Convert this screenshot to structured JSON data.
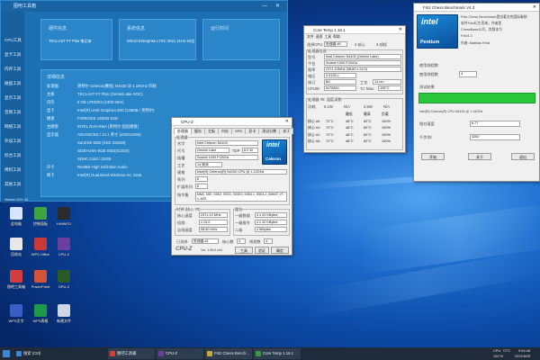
{
  "toolbox": {
    "title": "图吧工具箱",
    "sidebar": [
      "CPU工具",
      "显卡工具",
      "内存工具",
      "磁盘工具",
      "显示工具",
      "音频工具",
      "网络工具",
      "外设工具",
      "综合工具",
      "烤机工具",
      "其他工具"
    ],
    "cards": [
      {
        "h": "硬件信息",
        "v": "TECLAST F7 Plus 笔记本"
      },
      {
        "h": "系统信息",
        "v": "Win10 Enterprise LTSC 2021 21H2 64位"
      },
      {
        "h": "运行时间",
        "v": ""
      }
    ],
    "detail_title": "详细信息",
    "detail_rows": [
      {
        "k": "处理器",
        "v": "英特尔 Celeron(赛扬) N4100 @ 1.10GHz 四核"
      },
      {
        "k": "主板",
        "v": "TECLAST F7 Plus (GeminiLake SOC)"
      },
      {
        "k": "内存",
        "v": "8 GB LPDDR4 (2400 MHz)"
      },
      {
        "k": "显卡",
        "v": "Intel(R) UHD Graphics 600 (128MB / 英特尔)"
      },
      {
        "k": "硬盘",
        "v": "FORESEE 128GB SSD"
      },
      {
        "k": "主硬盘",
        "v": "INTEL NVS-RMA (英特尔 固态硬盘)"
      },
      {
        "k": "显示器",
        "v": "ADVANCED / 14.1 英寸 (1920x1080)"
      },
      {
        "k": "",
        "v": "SanDisk SDB (SSD 256GB)"
      },
      {
        "k": "",
        "v": "SD40-UNK-8GB SSD(512GB)"
      },
      {
        "k": "",
        "v": "SDHC Card / 32GB"
      },
      {
        "k": "声卡",
        "v": "Realtek High Definition Audio"
      },
      {
        "k": "网卡",
        "v": "Intel(R) Dual Band Wireless-AC 3165"
      }
    ],
    "version": "Version 2021.10"
  },
  "cpuz": {
    "title": "CPU-Z",
    "tabs": [
      "处理器",
      "缓存",
      "主板",
      "内存",
      "SPD",
      "显卡",
      "测试分数",
      "关于"
    ],
    "group_processor": "处理器",
    "fields": [
      {
        "k": "名字",
        "v": "Intel Celeron N4100"
      },
      {
        "k": "代号",
        "v": "Gemini Lake"
      },
      {
        "k": "插槽",
        "v": "Socket 1090 FCBGA"
      },
      {
        "k": "工艺",
        "v": "14 纳米"
      },
      {
        "k": "规格",
        "v": "Intel(R) Celeron(R) N4100 CPU @ 1.10GHz"
      },
      {
        "k": "系列",
        "v": "6"
      },
      {
        "k": "扩展系列",
        "v": "6"
      },
      {
        "k": "指令集",
        "v": "MMX, SSE, SSE2, SSE3, SSSE3, SSE4.1, SSE4.2, EM64T, VT-x, AES"
      }
    ],
    "tdp_label": "TDP",
    "tdp": "6.0 W",
    "clock_group": "时钟 (核心 #0)",
    "cache_group": "缓存",
    "clock": [
      {
        "k": "核心速度",
        "v": "2371.10 MHz"
      },
      {
        "k": "倍频",
        "v": "x 24.0"
      },
      {
        "k": "总线速度",
        "v": "98.80 MHz"
      }
    ],
    "cache": [
      {
        "k": "一级数据",
        "v": "4 x 24 KBytes"
      },
      {
        "k": "一级指令",
        "v": "4 x 32 KBytes"
      },
      {
        "k": "二级",
        "v": "4 MBytes"
      }
    ],
    "select_label": "已选择",
    "select_value": "处理器 #1",
    "cores_label": "核心数",
    "cores": "4",
    "threads_label": "线程数",
    "threads": "4",
    "footer_ver": "Ver. 1.98.0.x64",
    "tools_label": "工具",
    "validate_label": "验证",
    "ok_label": "确定",
    "logo": "CPU-Z",
    "intel_badge": "intel",
    "intel_sub": "Celeron"
  },
  "coretemp": {
    "title": "Core Temp 1.16.1",
    "menu": [
      "文件",
      "选项",
      "工具",
      "帮助"
    ],
    "select_label": "选择CPU:",
    "select_value": "处理器 #0",
    "cores": "4 核心",
    "threads": "4 线程",
    "info_label": "处理器信息",
    "fields": [
      {
        "k": "型号",
        "v": "Intel Celeron N4100 (Gemini Lake)"
      },
      {
        "k": "平台",
        "v": "Socket 1090 FCBGA"
      },
      {
        "k": "频率",
        "v": "2371.10MHz (98.80 x 24.0)"
      },
      {
        "k": "电压",
        "v": "0.9126 v"
      },
      {
        "k": "修订",
        "v": "B0"
      },
      {
        "k": "工艺",
        "v": "14 nm"
      },
      {
        "k": "CPUID",
        "v": "0x706A1"
      }
    ],
    "tj_label": "TJ. Max:",
    "tj": "105°C",
    "temp_title": "处理器 #0: 温度读数",
    "power_label": "功耗:",
    "power_vals": [
      "6.1W",
      "N/A",
      "2.5W",
      "N/A"
    ],
    "tolerance_label": "Tj. Max:",
    "header": [
      "",
      "最低",
      "最高",
      "负载"
    ],
    "rows": [
      {
        "k": "核心 #0:",
        "cur": "72°C",
        "min": "48°C",
        "max": "82°C",
        "load": "100%"
      },
      {
        "k": "核心 #1:",
        "cur": "72°C",
        "min": "48°C",
        "max": "82°C",
        "load": "100%"
      },
      {
        "k": "核心 #2:",
        "cur": "72°C",
        "min": "48°C",
        "max": "82°C",
        "load": "100%"
      },
      {
        "k": "核心 #3:",
        "cur": "72°C",
        "min": "48°C",
        "max": "82°C",
        "load": "100%"
      }
    ]
  },
  "fritz": {
    "title": "Fritz Chess Benchmark V4.3",
    "header_lines": [
      "Fritz Chess Benchmark是由著名的国际象棋",
      "软件Fritz衍生而来，作者是",
      "ChessBase公司，其版本为",
      "Fritz4.3"
    ],
    "author_line": "作者: Mathias Feist",
    "threads_label": "使用线程数",
    "threads_value": "4",
    "test_label": "测试结果",
    "progress": 1.0,
    "relative_label": "相对速度",
    "relative_value": "6.77",
    "knps_label": "千步/秒",
    "knps_value": "3250",
    "cpu_line": "Intel(R) Celeron(R) CPU N4100 @ 1.10GHz",
    "start_label": "开始",
    "about_label": "关于",
    "close_label": "退出",
    "intel_badge": "intel",
    "intel_sub": "Pentium"
  },
  "desktop_icons": [
    {
      "n": "此电脑",
      "c": "#d7e6ff"
    },
    {
      "n": "控制面板",
      "c": "#3fa33f"
    },
    {
      "n": "HWiNFO",
      "c": "#2b2b2b"
    },
    {
      "n": "回收站",
      "c": "#e8e8e8"
    },
    {
      "n": "WPS Office",
      "c": "#c83a3a"
    },
    {
      "n": "CPU-Z",
      "c": "#6b3fa0"
    },
    {
      "n": "图吧工具箱",
      "c": "#d23d3d"
    },
    {
      "n": "PowerPoint",
      "c": "#d2523a"
    },
    {
      "n": "GPU-Z",
      "c": "#2a5a2a"
    },
    {
      "n": "WPS文字",
      "c": "#3a5ec8"
    },
    {
      "n": "WPS表格",
      "c": "#1f9a4a"
    },
    {
      "n": "新建文件",
      "c": "#cfd7e6"
    }
  ],
  "taskbar": {
    "items": [
      {
        "n": "搜索 (Ctrl)",
        "c": "#3a86d8"
      },
      {
        "n": "图吧工具箱",
        "c": "#d23d3d"
      },
      {
        "n": "CPU-Z",
        "c": "#6b3fa0"
      },
      {
        "n": "Fritz Chess Bench...",
        "c": "#c8a83a"
      },
      {
        "n": "Core Temp 1.16.1",
        "c": "#3a9a3a"
      }
    ],
    "tray_lines": [
      "CPU: 72°C",
      "100 %"
    ],
    "time": "9:04:48",
    "date": "2021/6/29"
  }
}
